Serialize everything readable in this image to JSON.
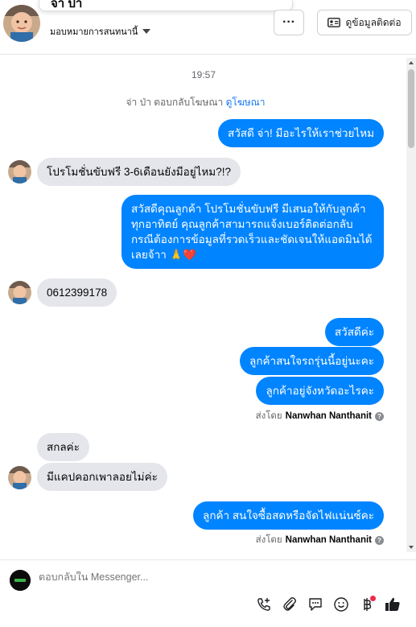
{
  "header": {
    "contact_name": "จ่า ป่า",
    "assign_label": "มอบหมายการสนทนานี้",
    "more_label": "···",
    "contact_info_label": "ดูข้อมูลติดต่อ"
  },
  "conversation": {
    "timestamp": "19:57",
    "ad_reply_text": "จ่า ป่า ตอบกลับโฆษณา",
    "ad_link_label": "ดูโฆษณา",
    "messages": [
      {
        "side": "out",
        "text": "สวัสดี จ่า! มีอะไรให้เราช่วยไหม"
      },
      {
        "side": "in",
        "text": "โปรโมชั่นขับฟรี 3-6เดือนยังมีอยู่ไหม?!?"
      },
      {
        "side": "out",
        "text": "สวัสดีคุณลูกค้า โปรโมชั่นขับฟรี มีเสนอให้กับลูกค้าทุกอาทิตย์ คุณลูกค้าสามารถแจ้งเบอร์ติดต่อกลับกรณีต้องการข้อมูลที่รวดเร็วและชัดเจนให้แอดมินได้เลยจ้าา 🙏❤️"
      },
      {
        "side": "in",
        "text": "0612399178"
      },
      {
        "side": "out",
        "text": "สวัสดีค่ะ"
      },
      {
        "side": "out",
        "text": "ลูกค้าสนใจรถรุ่นนี้อยู่นะคะ"
      },
      {
        "side": "out",
        "text": "ลูกค้าอยู่จังหวัดอะไรคะ"
      },
      {
        "side": "in",
        "text": "สกลค่ะ"
      },
      {
        "side": "in",
        "text": "มีแคปคอกเพาลอยไม่ค่ะ"
      },
      {
        "side": "out",
        "text": "ลูกค้า สนใจซื้อสดหรือจัดไฟแน่นซ์คะ"
      }
    ],
    "sent_by_label": "ส่งโดย",
    "sender_name": "Nanwhan Nanthanit"
  },
  "composer": {
    "placeholder": "ตอบกลับใน Messenger..."
  },
  "colors": {
    "outgoing_bubble": "#0084ff",
    "incoming_bubble": "#e4e6eb",
    "link": "#1877f2"
  },
  "icons": [
    "contact-card-icon",
    "chevron-down-icon",
    "phone-plus-icon",
    "attach-icon",
    "chat-bubble-icon",
    "emoji-icon",
    "baht-icon",
    "thumbs-up-icon"
  ]
}
